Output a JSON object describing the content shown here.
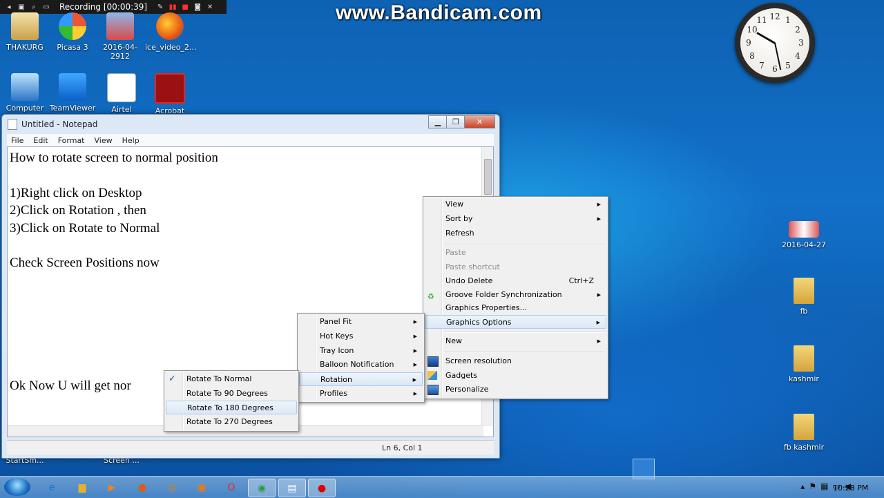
{
  "recorder": {
    "status": "Recording [00:00:39]"
  },
  "watermark": "www.Bandicam.com",
  "desktop_icons_left": [
    "THAKURG",
    "Picasa 3",
    "2016-04-2912",
    "ice_video_2...",
    "Computer",
    "TeamViewer",
    "Airtel",
    "Acrobat"
  ],
  "desktop_icons_bottom": [
    "StartSm...",
    "Screen ..."
  ],
  "desktop_icons_right": [
    "2016-04-27",
    "fb",
    "kashmir",
    "fb kashmir"
  ],
  "clock": {
    "numbers": [
      "12",
      "1",
      "2",
      "3",
      "4",
      "5",
      "6",
      "7",
      "8",
      "9",
      "10",
      "11"
    ]
  },
  "notepad": {
    "title": "Untitled - Notepad",
    "menu": [
      "File",
      "Edit",
      "Format",
      "View",
      "Help"
    ],
    "lines": [
      "How to rotate screen to normal position",
      "",
      "1)Right click on Desktop",
      "2)Click on Rotation , then",
      "3)Click on Rotate to Normal",
      "",
      "Check Screen Positions now",
      "",
      "",
      "",
      "",
      "",
      "",
      "Ok Now U will get nor"
    ],
    "status": "Ln 6, Col 1"
  },
  "context_menu": {
    "view": "View",
    "sort_by": "Sort by",
    "refresh": "Refresh",
    "paste": "Paste",
    "paste_shortcut": "Paste shortcut",
    "undo_delete": "Undo Delete",
    "undo_shortcut": "Ctrl+Z",
    "groove": "Groove Folder Synchronization",
    "graphics_properties": "Graphics Properties...",
    "graphics_options": "Graphics Options",
    "new": "New",
    "screen_resolution": "Screen resolution",
    "gadgets": "Gadgets",
    "personalize": "Personalize"
  },
  "graphics_submenu": [
    "Panel Fit",
    "Hot Keys",
    "Tray Icon",
    "Balloon Notification",
    "Rotation",
    "Profiles"
  ],
  "rotation_submenu": [
    "Rotate To Normal",
    "Rotate To 90 Degrees",
    "Rotate To 180 Degrees",
    "Rotate To 270 Degrees"
  ],
  "taskbar": {
    "time": "10:28 PM"
  },
  "colors": {
    "desktop": "#1270c8",
    "menu_bg": "#f0f0f0",
    "highlight": "#dbe7f7"
  }
}
